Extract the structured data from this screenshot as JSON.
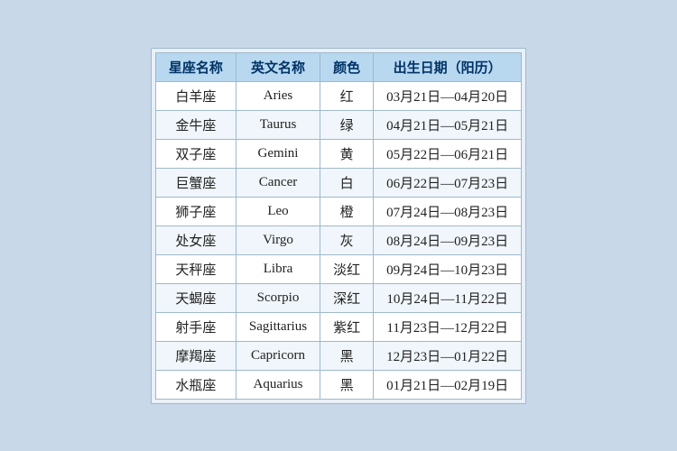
{
  "table": {
    "headers": [
      "星座名称",
      "英文名称",
      "颜色",
      "出生日期（阳历）"
    ],
    "rows": [
      [
        "白羊座",
        "Aries",
        "红",
        "03月21日—04月20日"
      ],
      [
        "金牛座",
        "Taurus",
        "绿",
        "04月21日—05月21日"
      ],
      [
        "双子座",
        "Gemini",
        "黄",
        "05月22日—06月21日"
      ],
      [
        "巨蟹座",
        "Cancer",
        "白",
        "06月22日—07月23日"
      ],
      [
        "狮子座",
        "Leo",
        "橙",
        "07月24日—08月23日"
      ],
      [
        "处女座",
        "Virgo",
        "灰",
        "08月24日—09月23日"
      ],
      [
        "天秤座",
        "Libra",
        "淡红",
        "09月24日—10月23日"
      ],
      [
        "天蝎座",
        "Scorpio",
        "深红",
        "10月24日—11月22日"
      ],
      [
        "射手座",
        "Sagittarius",
        "紫红",
        "11月23日—12月22日"
      ],
      [
        "摩羯座",
        "Capricorn",
        "黑",
        "12月23日—01月22日"
      ],
      [
        "水瓶座",
        "Aquarius",
        "黑",
        "01月21日—02月19日"
      ]
    ]
  }
}
